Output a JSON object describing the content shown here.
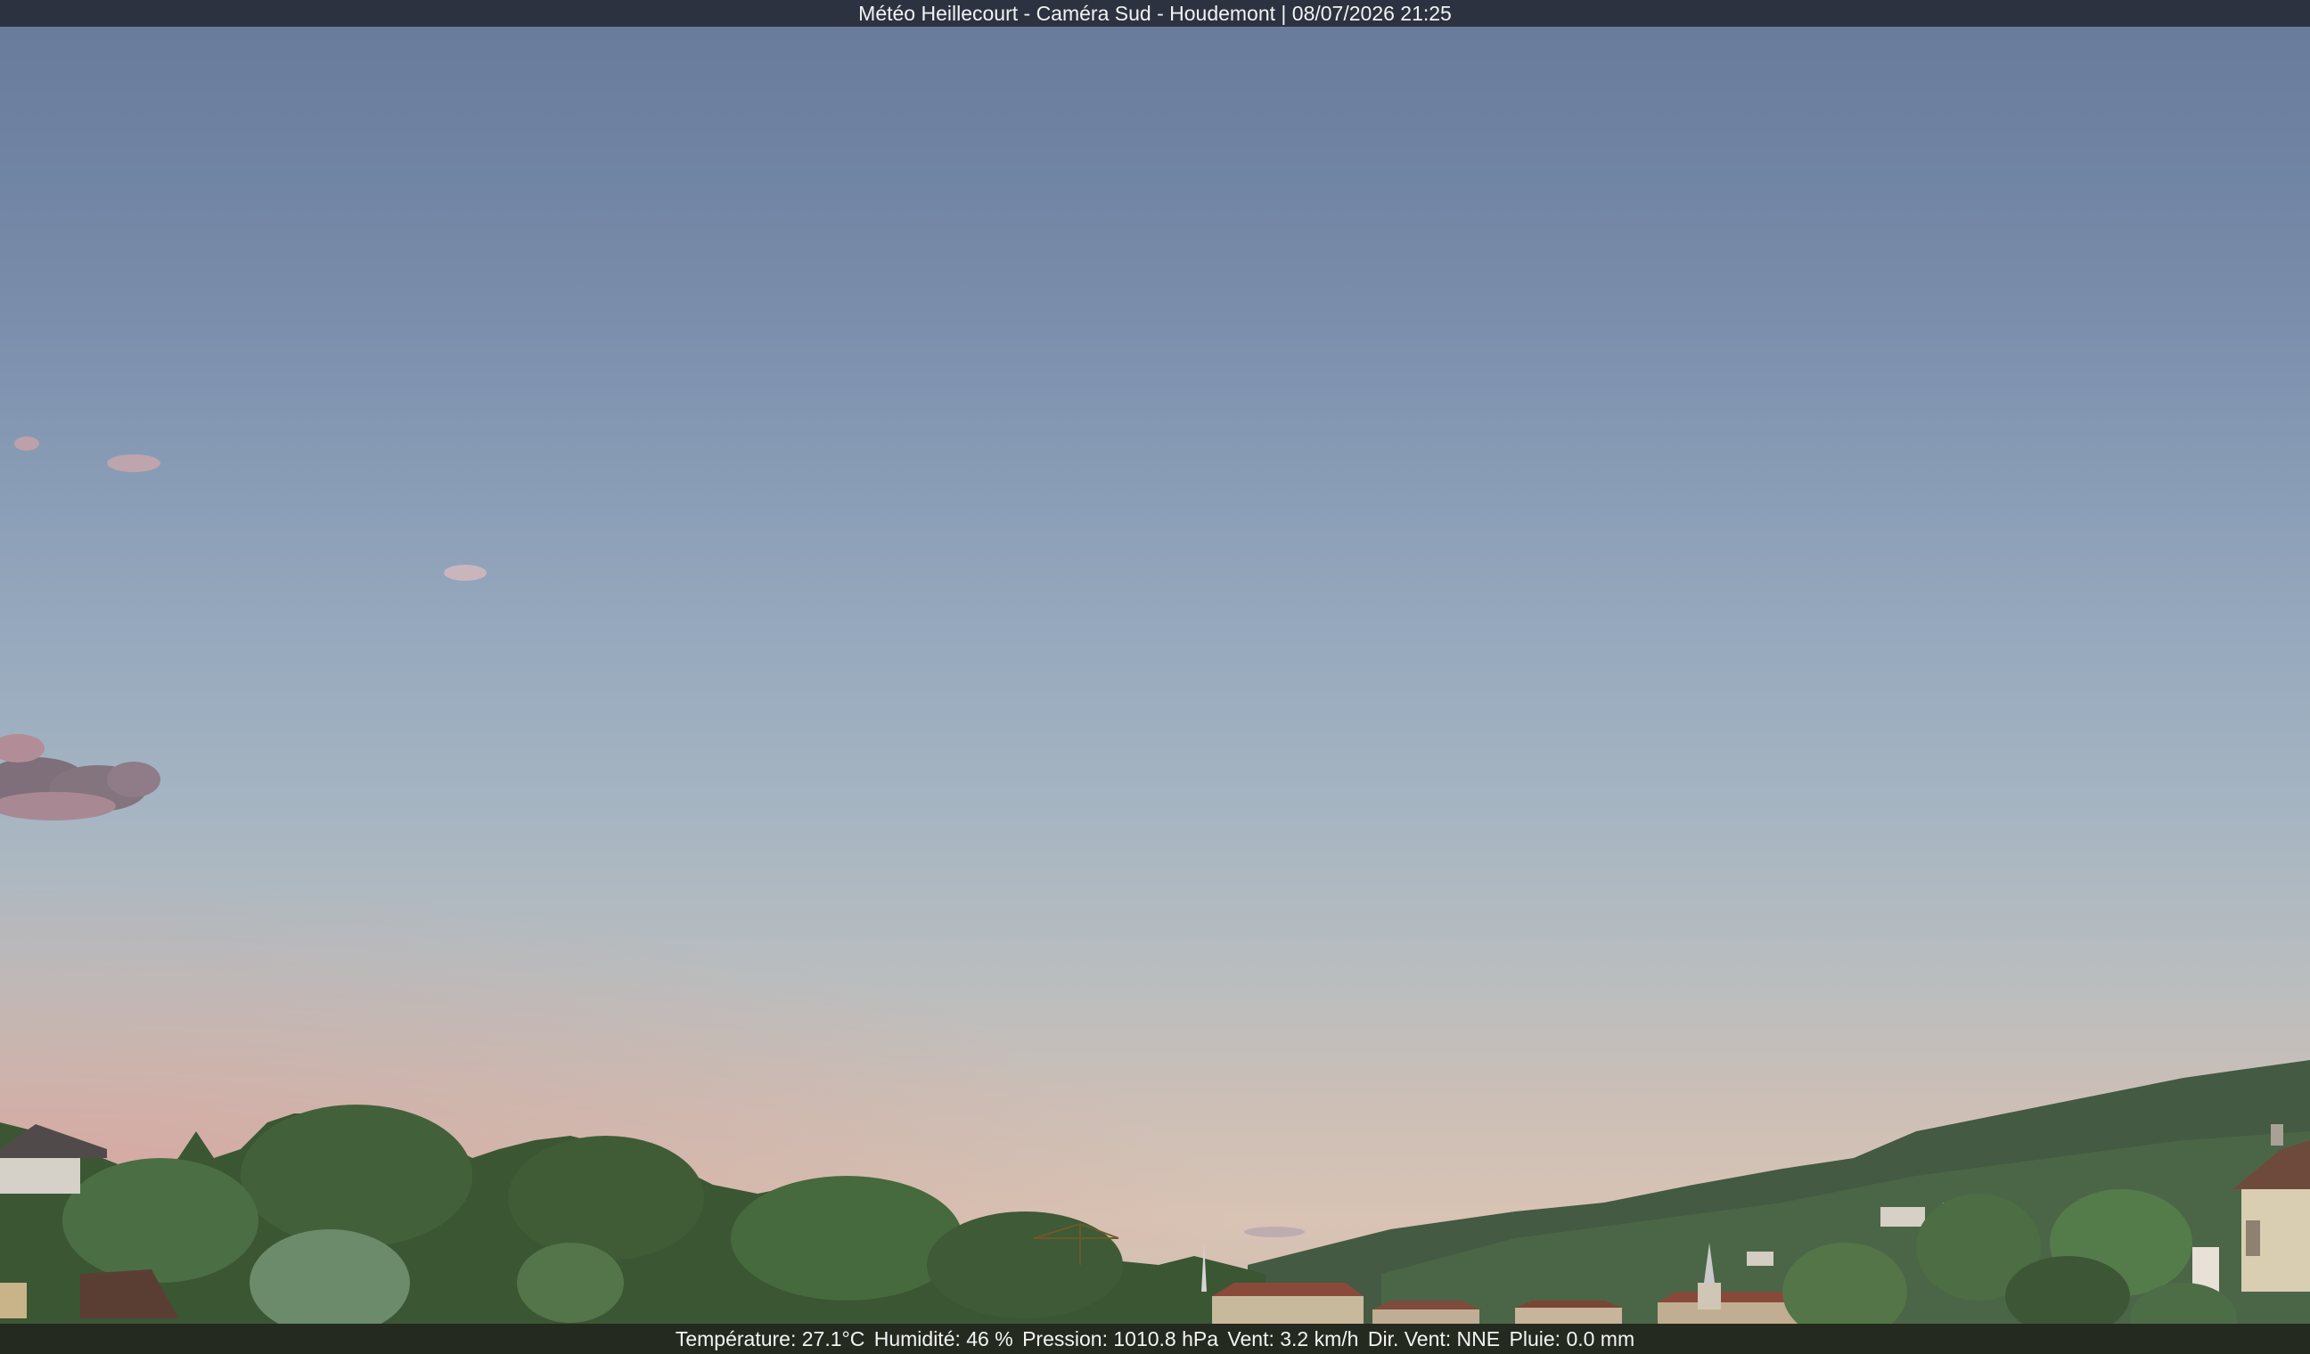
{
  "title_bar": {
    "text": "Météo Heillecourt - Caméra Sud - Houdemont | 08/07/2026 21:25"
  },
  "weather": {
    "temperature": "Température: 27.1°C",
    "humidity": "Humidité: 46 %",
    "pressure": "Pression: 1010.8 hPa",
    "wind_speed": "Vent: 3.2 km/h",
    "wind_direction": "Dir. Vent: NNE",
    "rain": "Pluie: 0.0 mm"
  },
  "colors": {
    "title_bar_bg": "#2c3240",
    "sky_top": "#697a99",
    "sky_horizon": "#d8c3b4",
    "trees": "#3c5a34"
  }
}
